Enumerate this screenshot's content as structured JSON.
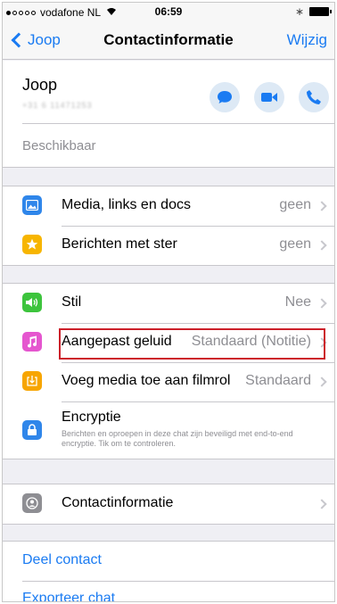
{
  "status_bar": {
    "carrier": "vodafone NL",
    "time": "06:59"
  },
  "nav": {
    "back_label": "Joop",
    "title": "Contactinformatie",
    "edit_label": "Wijzig"
  },
  "contact": {
    "name": "Joop",
    "number": "+31 6 11471253",
    "status": "Beschikbaar"
  },
  "media_group": [
    {
      "label": "Media, links en docs",
      "value": "geen"
    },
    {
      "label": "Berichten met ster",
      "value": "geen"
    }
  ],
  "settings_group": {
    "mute": {
      "label": "Stil",
      "value": "Nee"
    },
    "sound": {
      "label": "Aangepast geluid",
      "value": "Standaard (Notitie)"
    },
    "save_media": {
      "label": "Voeg media toe aan filmrol",
      "value": "Standaard"
    },
    "encryption": {
      "label": "Encryptie",
      "description": "Berichten en oproepen in deze chat zijn beveiligd met end-to-end encryptie. Tik om te controleren."
    }
  },
  "info_group": {
    "label": "Contactinformatie"
  },
  "actions": {
    "share": "Deel contact",
    "export": "Exporteer chat"
  },
  "colors": {
    "accent": "#1a7bf2",
    "highlight": "#cc1f2a"
  }
}
